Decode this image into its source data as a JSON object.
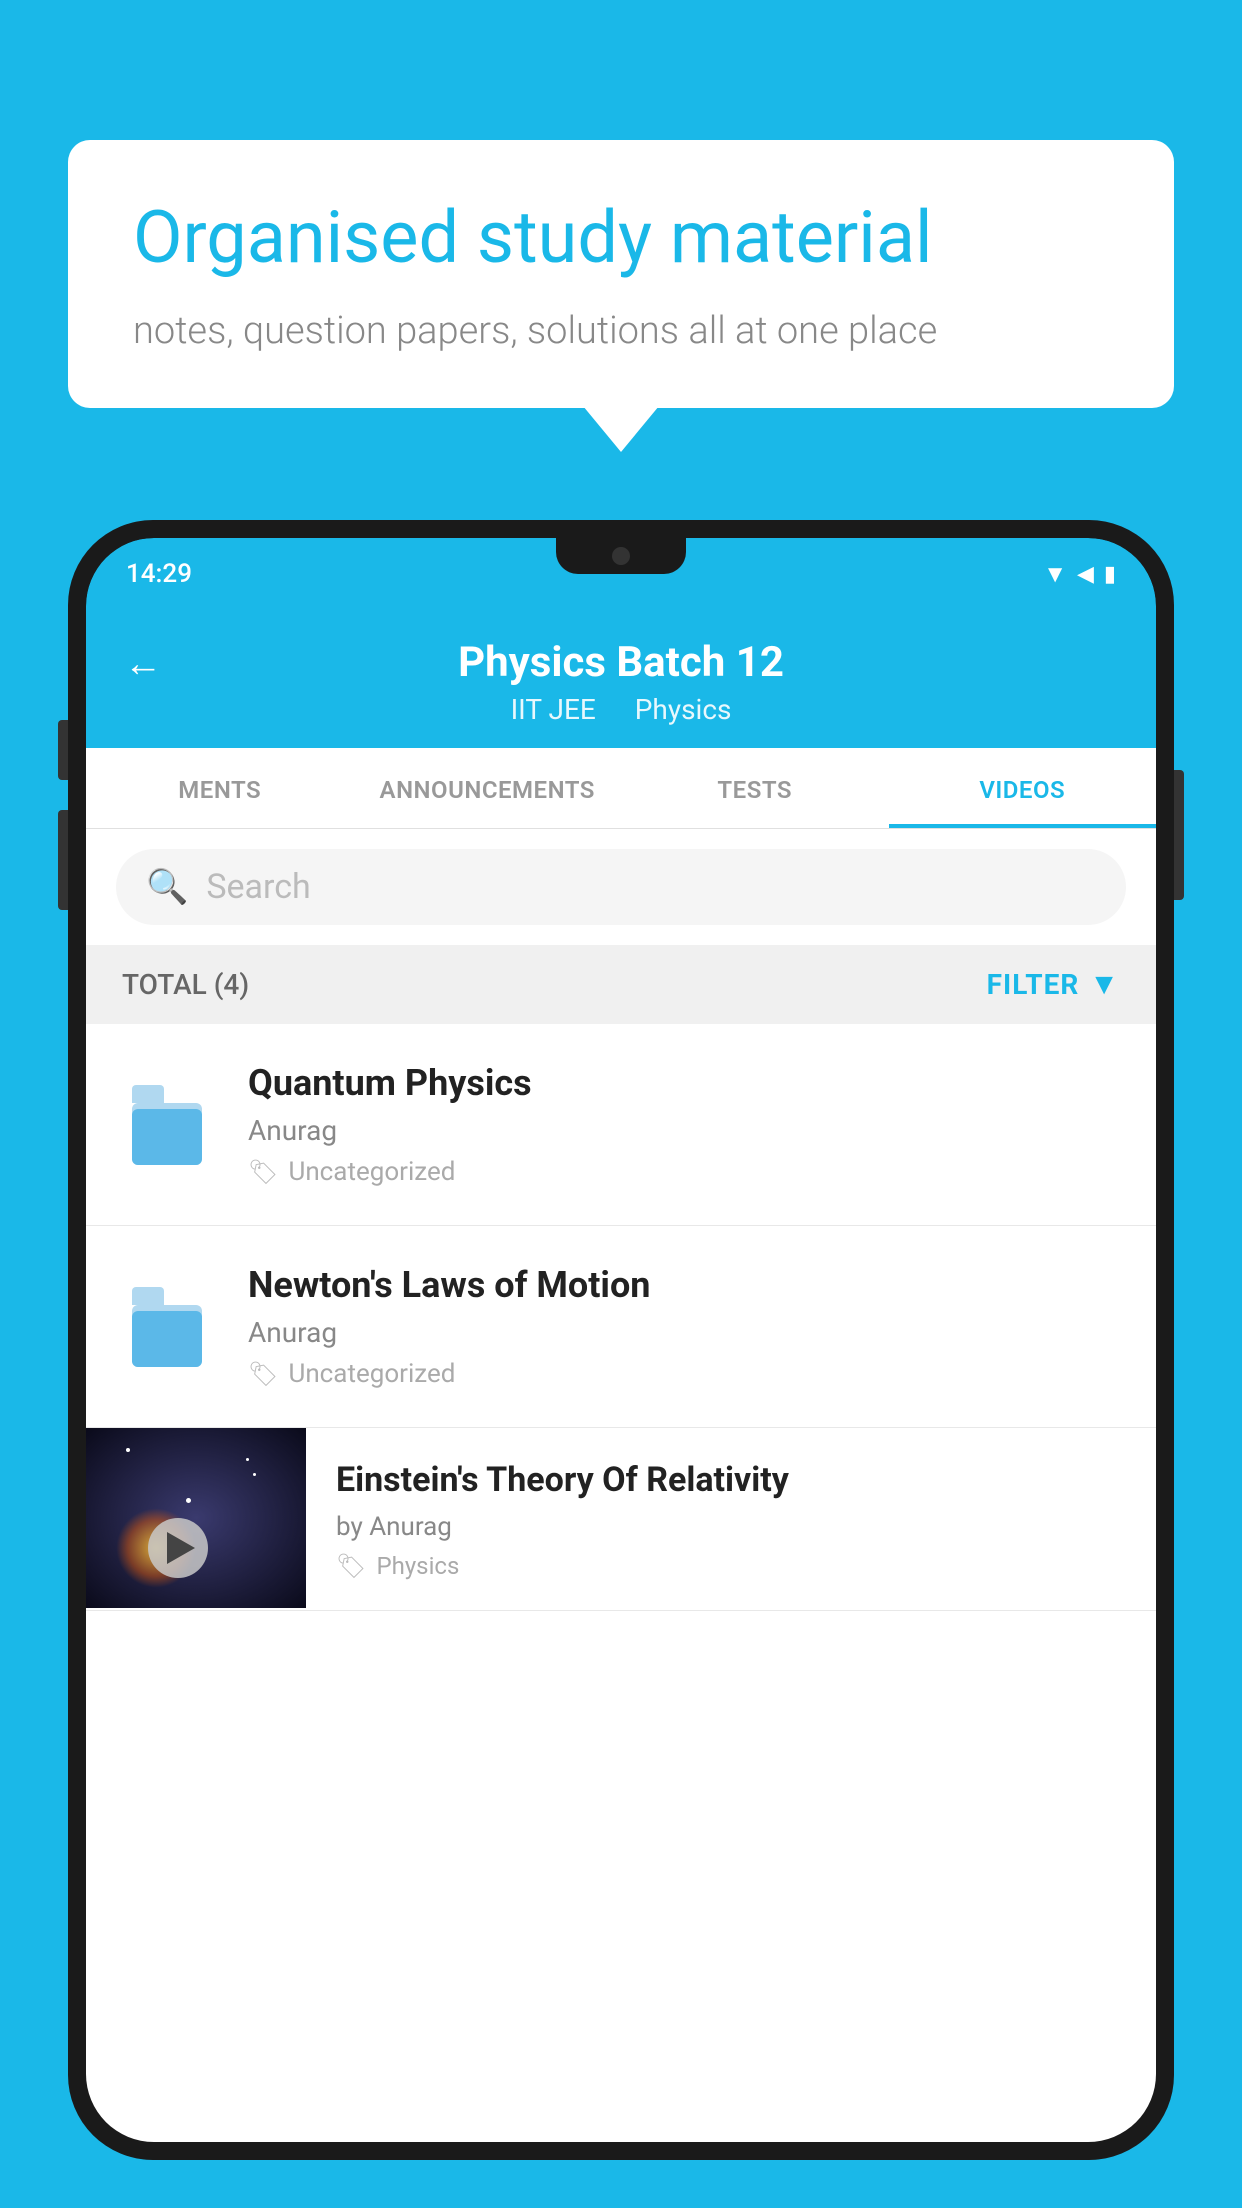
{
  "background_color": "#1ab8e8",
  "speech_bubble": {
    "heading": "Organised study material",
    "subtext": "notes, question papers, solutions all at one place"
  },
  "phone": {
    "status_bar": {
      "time": "14:29",
      "icons": [
        "wifi",
        "signal",
        "battery"
      ]
    },
    "header": {
      "back_label": "←",
      "title": "Physics Batch 12",
      "subtitle_part1": "IIT JEE",
      "subtitle_part2": "Physics"
    },
    "tabs": [
      {
        "label": "MENTS",
        "active": false
      },
      {
        "label": "ANNOUNCEMENTS",
        "active": false
      },
      {
        "label": "TESTS",
        "active": false
      },
      {
        "label": "VIDEOS",
        "active": true
      }
    ],
    "search": {
      "placeholder": "Search"
    },
    "filter_bar": {
      "total_label": "TOTAL (4)",
      "filter_label": "FILTER"
    },
    "videos": [
      {
        "id": 1,
        "title": "Quantum Physics",
        "author": "Anurag",
        "tag": "Uncategorized",
        "has_thumbnail": false
      },
      {
        "id": 2,
        "title": "Newton's Laws of Motion",
        "author": "Anurag",
        "tag": "Uncategorized",
        "has_thumbnail": false
      },
      {
        "id": 3,
        "title": "Einstein's Theory Of Relativity",
        "author": "by Anurag",
        "tag": "Physics",
        "has_thumbnail": true
      }
    ]
  }
}
